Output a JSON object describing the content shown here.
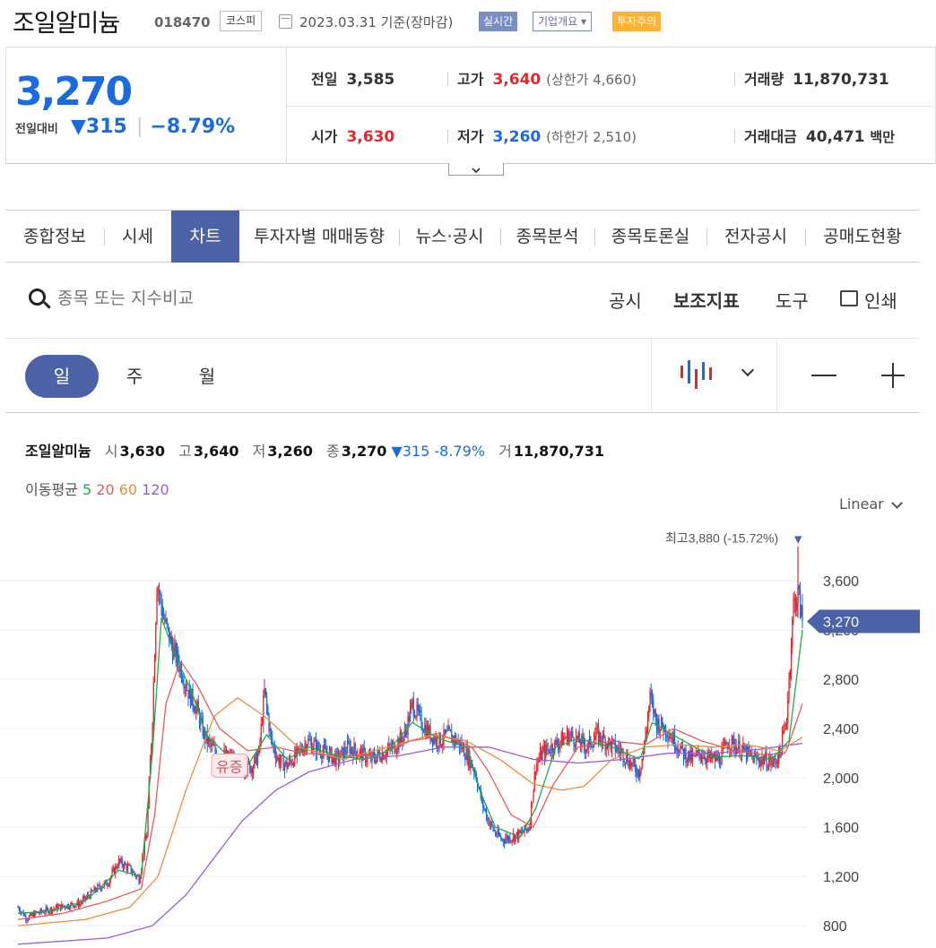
{
  "header": {
    "stock_name": "조일알미늄",
    "code": "018470",
    "market": "코스피",
    "date": "2023.03.31",
    "basis": "기준(장마감)",
    "tag_realtime": "실시간",
    "tag_company": "기업개요",
    "tag_warning": "투자주의"
  },
  "price": {
    "current": "3,270",
    "compare_label": "전일대비",
    "change": "315",
    "change_pct": "−8.79%",
    "prev_label": "전일",
    "prev": "3,585",
    "high_label": "고가",
    "high": "3,640",
    "upper_limit": "(상한가 4,660)",
    "volume_label": "거래량",
    "volume": "11,870,731",
    "open_label": "시가",
    "open": "3,630",
    "low_label": "저가",
    "low": "3,260",
    "lower_limit": "(하한가 2,510)",
    "amount_label": "거래대금",
    "amount": "40,471",
    "amount_unit": "백만"
  },
  "tabs": [
    "종합정보",
    "시세",
    "차트",
    "투자자별 매매동향",
    "뉴스·공시",
    "종목분석",
    "종목토론실",
    "전자공시",
    "공매도현황"
  ],
  "search": {
    "placeholder": "종목 또는 지수비교"
  },
  "tools": {
    "notice": "공시",
    "indicator": "보조지표",
    "drawing": "도구",
    "print": "인쇄"
  },
  "periods": [
    "일",
    "주",
    "월"
  ],
  "info": {
    "name": "조일알미늄",
    "o_label": "시",
    "o": "3,630",
    "h_label": "고",
    "h": "3,640",
    "l_label": "저",
    "l": "3,260",
    "c_label": "종",
    "c": "3,270",
    "chg": "▼315 -8.79%",
    "v_label": "거",
    "v": "11,870,731"
  },
  "ma": {
    "label": "이동평균",
    "p5": "5",
    "p20": "20",
    "p60": "60",
    "p120": "120",
    "colors": {
      "p5": "#22aa44",
      "p20": "#e85a5a",
      "p60": "#f08c3c",
      "p120": "#9b59e0"
    }
  },
  "scale": "Linear",
  "chart_data": {
    "type": "candlestick",
    "ylim": [
      750,
      3950
    ],
    "yticks": [
      3600,
      3200,
      2800,
      2400,
      2000,
      1600,
      1200,
      800
    ],
    "ytick_labels": [
      "3,600",
      "3,200",
      "2,800",
      "2,400",
      "2,000",
      "1,600",
      "1,200",
      "800"
    ],
    "current": "3,270",
    "current_value": 3270,
    "high_annotation": "최고3,880 (-15.72%)",
    "high_value": 3880,
    "event_label": "유증",
    "up_color": "#e2282f",
    "down_color": "#1b6be0",
    "path_points": [
      [
        0,
        950
      ],
      [
        8,
        860
      ],
      [
        16,
        900
      ],
      [
        28,
        930
      ],
      [
        40,
        960
      ],
      [
        55,
        980
      ],
      [
        70,
        1100
      ],
      [
        80,
        1150
      ],
      [
        90,
        1320
      ],
      [
        100,
        1260
      ],
      [
        108,
        1180
      ],
      [
        115,
        1550
      ],
      [
        120,
        2500
      ],
      [
        124,
        3600
      ],
      [
        130,
        3300
      ],
      [
        138,
        3050
      ],
      [
        145,
        2900
      ],
      [
        152,
        2700
      ],
      [
        160,
        2550
      ],
      [
        166,
        2350
      ],
      [
        172,
        2250
      ],
      [
        180,
        2200
      ],
      [
        190,
        2150
      ],
      [
        200,
        2080
      ],
      [
        210,
        2100
      ],
      [
        215,
        2200
      ],
      [
        220,
        2700
      ],
      [
        226,
        2300
      ],
      [
        232,
        2150
      ],
      [
        240,
        2100
      ],
      [
        250,
        2200
      ],
      [
        258,
        2300
      ],
      [
        266,
        2250
      ],
      [
        275,
        2200
      ],
      [
        285,
        2150
      ],
      [
        295,
        2250
      ],
      [
        305,
        2200
      ],
      [
        315,
        2150
      ],
      [
        325,
        2200
      ],
      [
        335,
        2250
      ],
      [
        345,
        2350
      ],
      [
        352,
        2600
      ],
      [
        360,
        2450
      ],
      [
        368,
        2350
      ],
      [
        376,
        2300
      ],
      [
        384,
        2350
      ],
      [
        392,
        2300
      ],
      [
        400,
        2200
      ],
      [
        408,
        2050
      ],
      [
        414,
        1800
      ],
      [
        420,
        1650
      ],
      [
        426,
        1550
      ],
      [
        432,
        1500
      ],
      [
        440,
        1520
      ],
      [
        448,
        1540
      ],
      [
        456,
        1600
      ],
      [
        462,
        2100
      ],
      [
        468,
        2200
      ],
      [
        476,
        2250
      ],
      [
        484,
        2300
      ],
      [
        492,
        2350
      ],
      [
        500,
        2300
      ],
      [
        508,
        2250
      ],
      [
        516,
        2350
      ],
      [
        524,
        2300
      ],
      [
        532,
        2250
      ],
      [
        540,
        2200
      ],
      [
        548,
        2100
      ],
      [
        554,
        2050
      ],
      [
        558,
        2200
      ],
      [
        564,
        2650
      ],
      [
        570,
        2450
      ],
      [
        578,
        2400
      ],
      [
        586,
        2300
      ],
      [
        594,
        2200
      ],
      [
        602,
        2150
      ],
      [
        610,
        2200
      ],
      [
        618,
        2150
      ],
      [
        626,
        2150
      ],
      [
        634,
        2300
      ],
      [
        642,
        2250
      ],
      [
        650,
        2200
      ],
      [
        658,
        2150
      ],
      [
        666,
        2150
      ],
      [
        674,
        2120
      ],
      [
        680,
        2200
      ],
      [
        686,
        2500
      ],
      [
        692,
        3400
      ],
      [
        696,
        3500
      ],
      [
        700,
        3270
      ]
    ],
    "ma5_anchors": [
      [
        0,
        900
      ],
      [
        30,
        920
      ],
      [
        60,
        1000
      ],
      [
        90,
        1250
      ],
      [
        110,
        1200
      ],
      [
        120,
        2200
      ],
      [
        128,
        3300
      ],
      [
        140,
        3000
      ],
      [
        155,
        2700
      ],
      [
        168,
        2350
      ],
      [
        185,
        2200
      ],
      [
        205,
        2100
      ],
      [
        222,
        2350
      ],
      [
        240,
        2150
      ],
      [
        260,
        2250
      ],
      [
        285,
        2180
      ],
      [
        310,
        2150
      ],
      [
        330,
        2220
      ],
      [
        352,
        2450
      ],
      [
        375,
        2320
      ],
      [
        400,
        2250
      ],
      [
        412,
        1900
      ],
      [
        426,
        1600
      ],
      [
        448,
        1520
      ],
      [
        462,
        1750
      ],
      [
        480,
        2250
      ],
      [
        500,
        2320
      ],
      [
        530,
        2250
      ],
      [
        555,
        2150
      ],
      [
        566,
        2450
      ],
      [
        590,
        2320
      ],
      [
        620,
        2170
      ],
      [
        650,
        2180
      ],
      [
        672,
        2150
      ],
      [
        688,
        2300
      ],
      [
        700,
        3200
      ]
    ],
    "ma20_anchors": [
      [
        0,
        850
      ],
      [
        40,
        900
      ],
      [
        80,
        1000
      ],
      [
        110,
        1100
      ],
      [
        122,
        1700
      ],
      [
        132,
        2600
      ],
      [
        145,
        2950
      ],
      [
        160,
        2750
      ],
      [
        180,
        2400
      ],
      [
        205,
        2220
      ],
      [
        230,
        2250
      ],
      [
        255,
        2200
      ],
      [
        290,
        2180
      ],
      [
        320,
        2180
      ],
      [
        350,
        2300
      ],
      [
        380,
        2340
      ],
      [
        405,
        2250
      ],
      [
        420,
        2050
      ],
      [
        440,
        1700
      ],
      [
        460,
        1600
      ],
      [
        478,
        1950
      ],
      [
        500,
        2250
      ],
      [
        530,
        2300
      ],
      [
        560,
        2270
      ],
      [
        585,
        2400
      ],
      [
        610,
        2300
      ],
      [
        640,
        2220
      ],
      [
        665,
        2190
      ],
      [
        685,
        2200
      ],
      [
        700,
        2600
      ]
    ],
    "ma60_anchors": [
      [
        0,
        800
      ],
      [
        60,
        850
      ],
      [
        100,
        950
      ],
      [
        125,
        1200
      ],
      [
        150,
        1900
      ],
      [
        175,
        2500
      ],
      [
        196,
        2650
      ],
      [
        220,
        2500
      ],
      [
        250,
        2250
      ],
      [
        290,
        2150
      ],
      [
        330,
        2250
      ],
      [
        370,
        2350
      ],
      [
        400,
        2300
      ],
      [
        430,
        2150
      ],
      [
        460,
        1950
      ],
      [
        485,
        1900
      ],
      [
        505,
        1930
      ],
      [
        530,
        2150
      ],
      [
        560,
        2250
      ],
      [
        590,
        2270
      ],
      [
        620,
        2250
      ],
      [
        650,
        2270
      ],
      [
        680,
        2220
      ],
      [
        700,
        2330
      ]
    ],
    "ma120_anchors": [
      [
        0,
        650
      ],
      [
        80,
        700
      ],
      [
        120,
        800
      ],
      [
        150,
        1050
      ],
      [
        175,
        1350
      ],
      [
        200,
        1650
      ],
      [
        230,
        1900
      ],
      [
        260,
        2050
      ],
      [
        300,
        2150
      ],
      [
        340,
        2180
      ],
      [
        380,
        2250
      ],
      [
        420,
        2250
      ],
      [
        460,
        2150
      ],
      [
        500,
        2120
      ],
      [
        540,
        2150
      ],
      [
        580,
        2200
      ],
      [
        620,
        2200
      ],
      [
        660,
        2230
      ],
      [
        700,
        2280
      ]
    ]
  }
}
